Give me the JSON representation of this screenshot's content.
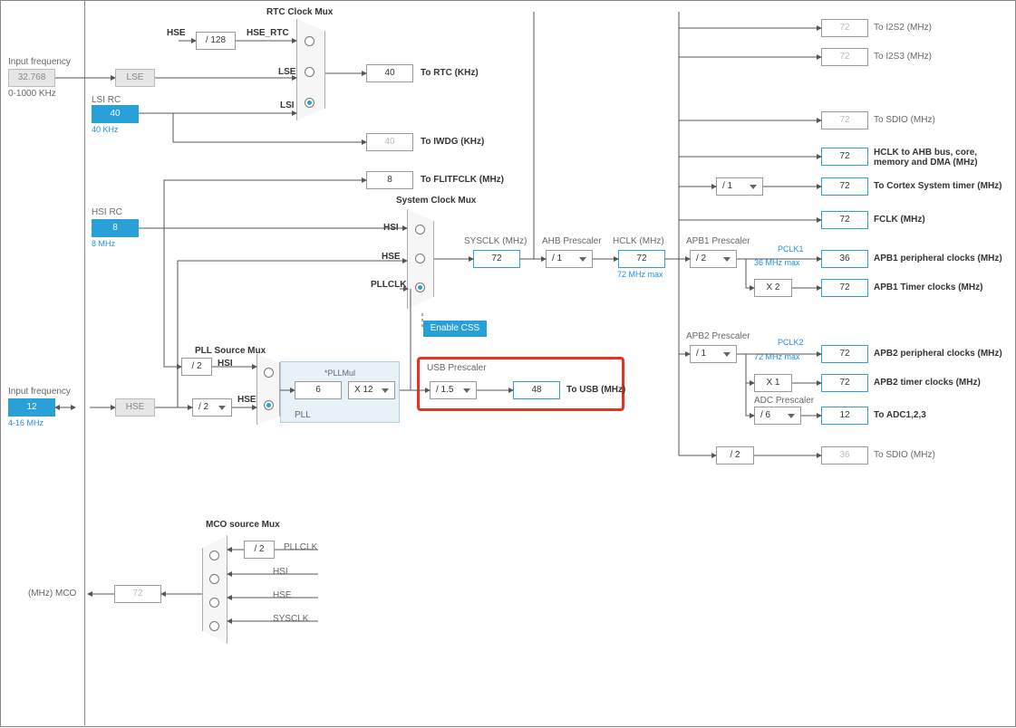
{
  "lse": {
    "input_label": "Input frequency",
    "value": "32.768",
    "range": "0-1000 KHz",
    "box_label": "LSE"
  },
  "lsi": {
    "label": "LSI RC",
    "value": "40",
    "note": "40 KHz"
  },
  "hsi": {
    "label": "HSI RC",
    "value": "8",
    "note": "8 MHz"
  },
  "hse": {
    "input_label": "Input frequency",
    "value": "12",
    "range": "4-16 MHz",
    "box_label": "HSE"
  },
  "rtc_mux": {
    "title": "RTC Clock Mux",
    "hse_label": "HSE",
    "hse_div": "/ 128",
    "hse_rtc": "HSE_RTC",
    "lse_label": "LSE",
    "lsi_label": "LSI",
    "out_value": "40",
    "out_label": "To RTC (KHz)"
  },
  "iwdg": {
    "value": "40",
    "label": "To IWDG (KHz)"
  },
  "flitf": {
    "value": "8",
    "label": "To FLITFCLK (MHz)"
  },
  "pll": {
    "mux_title": "PLL Source Mux",
    "hsi_label": "HSI",
    "hsi_div": "/ 2",
    "hse_label": "HSE",
    "hse_div": "/ 2",
    "pll_box_label": "PLL",
    "value": "6",
    "mul_label": "*PLLMul",
    "mul": "X 12"
  },
  "sysclk_mux": {
    "title": "System Clock Mux",
    "hsi": "HSI",
    "hse": "HSE",
    "pllclk": "PLLCLK",
    "css_btn": "Enable CSS"
  },
  "sysclk": {
    "label": "SYSCLK (MHz)",
    "value": "72"
  },
  "ahb": {
    "label": "AHB Prescaler",
    "div": "/ 1"
  },
  "hclk": {
    "label": "HCLK (MHz)",
    "value": "72",
    "note": "72 MHz max"
  },
  "usb": {
    "title": "USB Prescaler",
    "div": "/ 1.5",
    "value": "48",
    "label": "To USB (MHz)"
  },
  "cortex": {
    "div": "/ 1",
    "value": "72",
    "label": "To Cortex System timer (MHz)"
  },
  "ahb_bus": {
    "value": "72",
    "label": "HCLK to AHB bus, core, memory and DMA (MHz)"
  },
  "fclk": {
    "value": "72",
    "label": "FCLK (MHz)"
  },
  "sdio_top": {
    "value": "72",
    "label": "To SDIO (MHz)"
  },
  "i2s2": {
    "value": "72",
    "label": "To I2S2 (MHz)"
  },
  "i2s3": {
    "value": "72",
    "label": "To I2S3 (MHz)"
  },
  "apb1": {
    "label": "APB1 Prescaler",
    "div": "/ 2",
    "pclk1_label": "PCLK1",
    "pclk1_note": "36 MHz max",
    "periph_value": "36",
    "periph_label": "APB1 peripheral clocks (MHz)",
    "tim_mul": "X 2",
    "tim_value": "72",
    "tim_label": "APB1 Timer clocks (MHz)"
  },
  "apb2": {
    "label": "APB2 Prescaler",
    "div": "/ 1",
    "pclk2_label": "PCLK2",
    "pclk2_note": "72 MHz max",
    "periph_value": "72",
    "periph_label": "APB2 peripheral clocks (MHz)",
    "tim_mul": "X 1",
    "tim_value": "72",
    "tim_label": "APB2 timer clocks (MHz)",
    "adc_label": "ADC Prescaler",
    "adc_div": "/ 6",
    "adc_value": "12",
    "adc_out": "To ADC1,2,3"
  },
  "sdio_bot": {
    "div": "/ 2",
    "value": "36",
    "label": "To SDIO (MHz)"
  },
  "mco": {
    "title": "MCO source Mux",
    "pllclk": "PLLCLK",
    "pll_div": "/ 2",
    "hsi": "HSI",
    "hse": "HSE",
    "sysclk": "SYSCLK",
    "value": "72",
    "label": "(MHz) MCO"
  }
}
